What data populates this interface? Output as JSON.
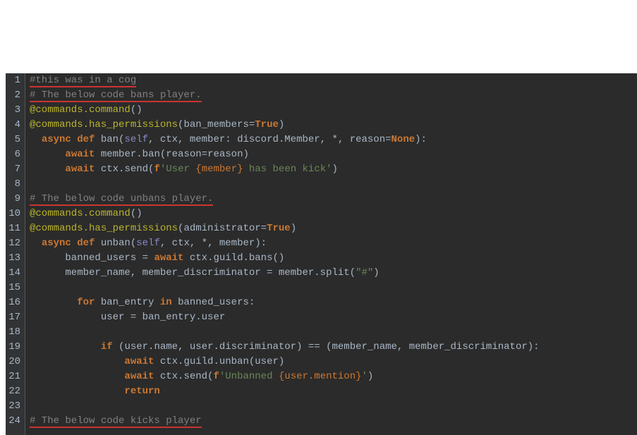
{
  "chart_data": null,
  "editor": {
    "language": "python",
    "line_numbers": [
      "1",
      "2",
      "3",
      "4",
      "5",
      "6",
      "7",
      "8",
      "9",
      "10",
      "11",
      "12",
      "13",
      "14",
      "15",
      "16",
      "17",
      "18",
      "19",
      "20",
      "21",
      "22",
      "23",
      "24"
    ],
    "lines": [
      [
        {
          "cls": "comment underline-red",
          "t": "#this was in a cog"
        }
      ],
      [
        {
          "cls": "comment underline-red",
          "t": "# The below code bans player."
        }
      ],
      [
        {
          "cls": "decor",
          "t": "@commands.command"
        },
        {
          "cls": "punct",
          "t": "()"
        }
      ],
      [
        {
          "cls": "decor",
          "t": "@commands.has_permissions"
        },
        {
          "cls": "punct",
          "t": "(ban_members="
        },
        {
          "cls": "keyword",
          "t": "True"
        },
        {
          "cls": "punct",
          "t": ")"
        }
      ],
      [
        {
          "cls": "",
          "t": "  "
        },
        {
          "cls": "keyword",
          "t": "async def "
        },
        {
          "cls": "",
          "t": "ban("
        },
        {
          "cls": "builtin",
          "t": "self"
        },
        {
          "cls": "",
          "t": ", ctx, member: discord.Member, *, reason="
        },
        {
          "cls": "keyword",
          "t": "None"
        },
        {
          "cls": "",
          "t": "):"
        }
      ],
      [
        {
          "cls": "",
          "t": "      "
        },
        {
          "cls": "keyword",
          "t": "await "
        },
        {
          "cls": "",
          "t": "member.ban(reason=reason)"
        }
      ],
      [
        {
          "cls": "",
          "t": "      "
        },
        {
          "cls": "keyword",
          "t": "await "
        },
        {
          "cls": "",
          "t": "ctx.send("
        },
        {
          "cls": "keyword",
          "t": "f"
        },
        {
          "cls": "string",
          "t": "'User "
        },
        {
          "cls": "fstr-ex",
          "t": "{member}"
        },
        {
          "cls": "string",
          "t": " has been kick'"
        },
        {
          "cls": "",
          "t": ")"
        }
      ],
      [
        {
          "cls": "",
          "t": ""
        }
      ],
      [
        {
          "cls": "comment underline-red",
          "t": "# The below code unbans player."
        }
      ],
      [
        {
          "cls": "decor",
          "t": "@commands.command"
        },
        {
          "cls": "punct",
          "t": "()"
        }
      ],
      [
        {
          "cls": "decor",
          "t": "@commands.has_permissions"
        },
        {
          "cls": "punct",
          "t": "(administrator="
        },
        {
          "cls": "keyword",
          "t": "True"
        },
        {
          "cls": "punct",
          "t": ")"
        }
      ],
      [
        {
          "cls": "",
          "t": "  "
        },
        {
          "cls": "keyword",
          "t": "async def "
        },
        {
          "cls": "",
          "t": "unban("
        },
        {
          "cls": "builtin",
          "t": "self"
        },
        {
          "cls": "",
          "t": ", ctx, *, member):"
        }
      ],
      [
        {
          "cls": "",
          "t": "      banned_users = "
        },
        {
          "cls": "keyword",
          "t": "await "
        },
        {
          "cls": "",
          "t": "ctx.guild.bans()"
        }
      ],
      [
        {
          "cls": "",
          "t": "      member_name, member_discriminator = member.split("
        },
        {
          "cls": "string",
          "t": "\"#\""
        },
        {
          "cls": "",
          "t": ")"
        }
      ],
      [
        {
          "cls": "",
          "t": ""
        }
      ],
      [
        {
          "cls": "",
          "t": "        "
        },
        {
          "cls": "keyword",
          "t": "for "
        },
        {
          "cls": "",
          "t": "ban_entry "
        },
        {
          "cls": "keyword",
          "t": "in "
        },
        {
          "cls": "",
          "t": "banned_users:"
        }
      ],
      [
        {
          "cls": "",
          "t": "            user = ban_entry.user"
        }
      ],
      [
        {
          "cls": "",
          "t": ""
        }
      ],
      [
        {
          "cls": "",
          "t": "            "
        },
        {
          "cls": "keyword",
          "t": "if "
        },
        {
          "cls": "",
          "t": "(user.name, user.discriminator) == (member_name, member_discriminator):"
        }
      ],
      [
        {
          "cls": "",
          "t": "                "
        },
        {
          "cls": "keyword",
          "t": "await "
        },
        {
          "cls": "",
          "t": "ctx.guild.unban(user)"
        }
      ],
      [
        {
          "cls": "",
          "t": "                "
        },
        {
          "cls": "keyword",
          "t": "await "
        },
        {
          "cls": "",
          "t": "ctx.send("
        },
        {
          "cls": "keyword",
          "t": "f"
        },
        {
          "cls": "string",
          "t": "'Unbanned "
        },
        {
          "cls": "fstr-ex",
          "t": "{user.mention}"
        },
        {
          "cls": "string",
          "t": "'"
        },
        {
          "cls": "",
          "t": ")"
        }
      ],
      [
        {
          "cls": "",
          "t": "                "
        },
        {
          "cls": "keyword",
          "t": "return"
        }
      ],
      [
        {
          "cls": "",
          "t": ""
        }
      ],
      [
        {
          "cls": "comment underline-red",
          "t": "# The below code kicks player"
        }
      ]
    ]
  }
}
